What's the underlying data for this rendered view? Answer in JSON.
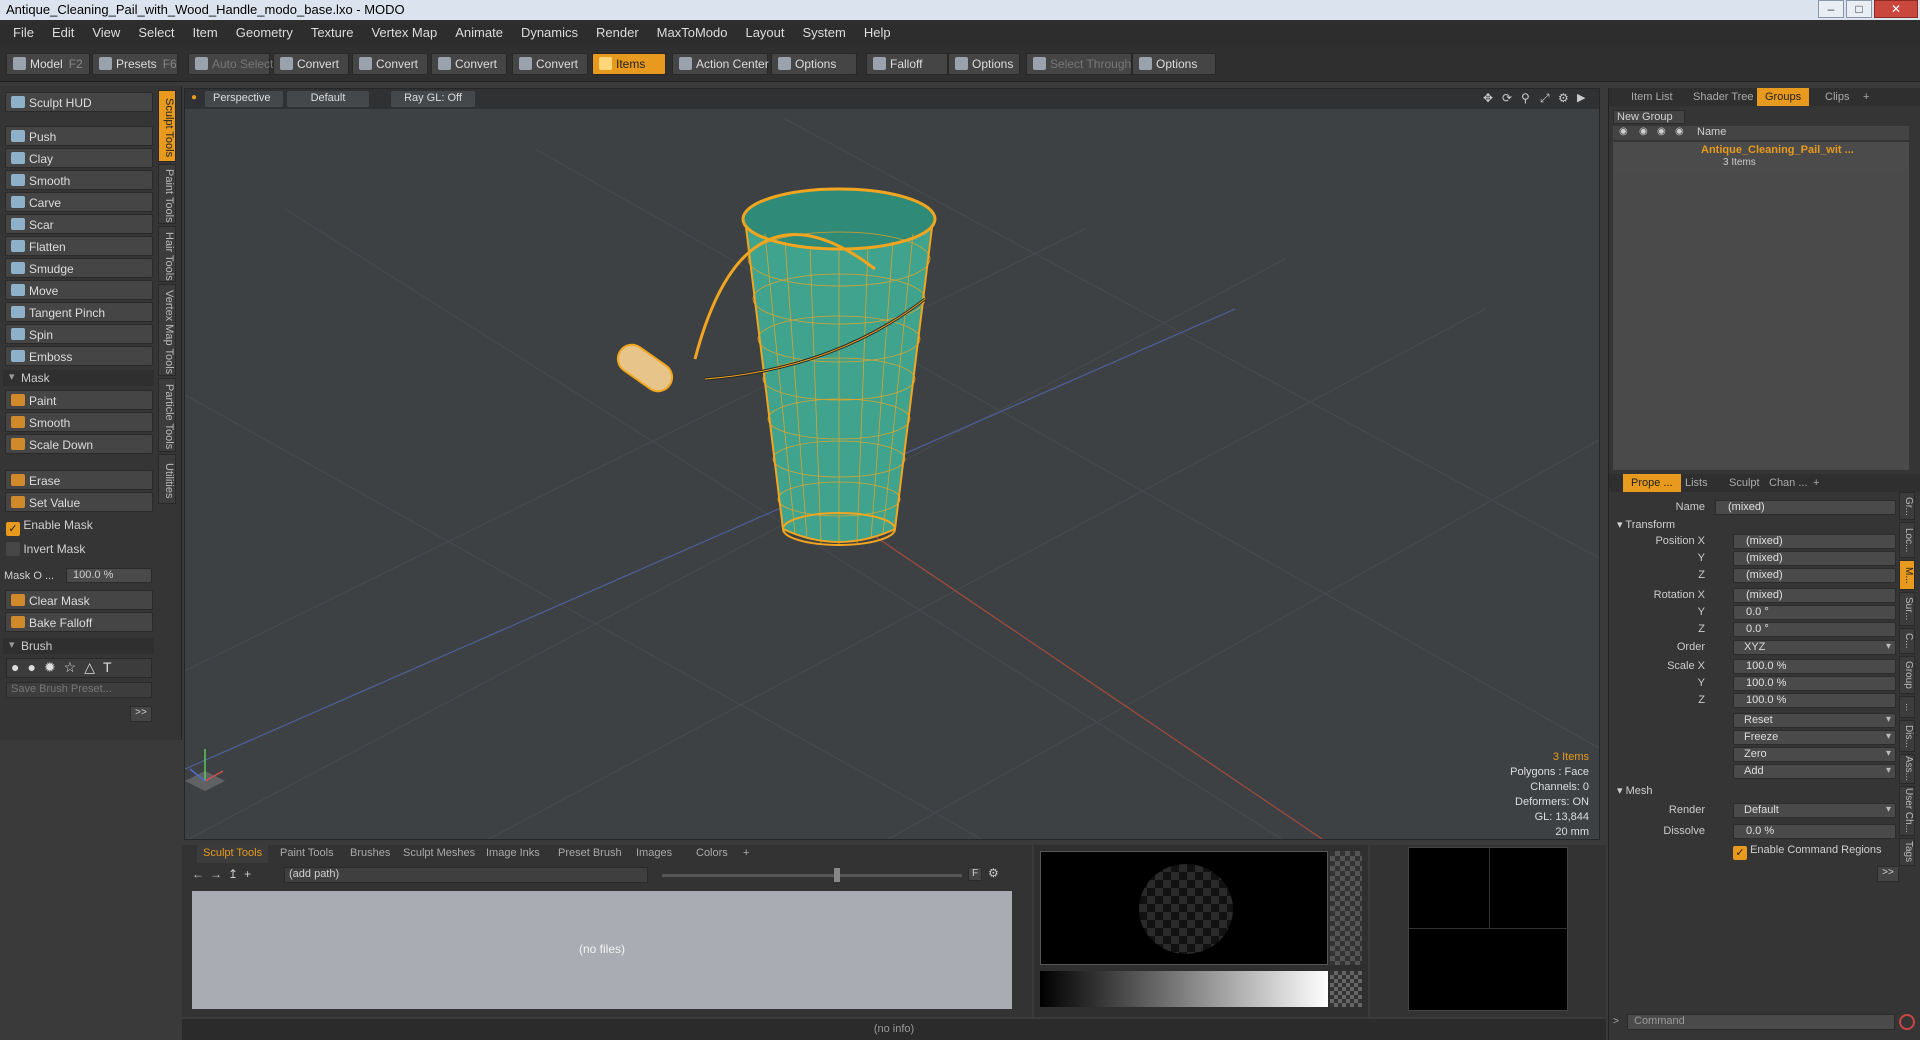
{
  "window": {
    "title": "Antique_Cleaning_Pail_with_Wood_Handle_modo_base.lxo - MODO"
  },
  "menu": [
    "File",
    "Edit",
    "View",
    "Select",
    "Item",
    "Geometry",
    "Texture",
    "Vertex Map",
    "Animate",
    "Dynamics",
    "Render",
    "MaxToModo",
    "Layout",
    "System",
    "Help"
  ],
  "toolbar": {
    "model": "Model",
    "model_key": "F2",
    "presets": "Presets",
    "presets_key": "F6",
    "auto_select": "Auto Select",
    "convert1": "Convert",
    "convert2": "Convert",
    "convert3": "Convert",
    "convert4": "Convert",
    "items": "Items",
    "action_center": "Action Center",
    "options1": "Options",
    "falloff": "Falloff",
    "options2": "Options",
    "select_through": "Select Through",
    "options3": "Options"
  },
  "left": {
    "sculpt_hud": "Sculpt HUD",
    "tools": [
      "Push",
      "Clay",
      "Smooth",
      "Carve",
      "Scar",
      "Flatten",
      "Smudge",
      "Move",
      "Tangent Pinch",
      "Spin",
      "Emboss"
    ],
    "mask_section": "Mask",
    "mask_tools": [
      "Paint",
      "Smooth",
      "Scale Down"
    ],
    "erase": "Erase",
    "set_value": "Set Value",
    "enable_mask": "Enable Mask",
    "invert_mask": "Invert Mask",
    "mask_opacity_label": "Mask O ...",
    "mask_opacity_value": "100.0 %",
    "clear_mask": "Clear Mask",
    "bake_falloff": "Bake Falloff",
    "brush_section": "Brush",
    "save_brush_placeholder": "Save Brush Preset...",
    "more": ">>",
    "vtabs": [
      "Sculpt Tools",
      "Paint Tools",
      "Hair Tools",
      "Vertex Map Tools",
      "Particle Tools",
      "Utilities"
    ]
  },
  "viewport": {
    "perspective": "Perspective",
    "default": "Default",
    "raygl": "Ray GL: Off",
    "info": [
      "3 Items",
      "Polygons : Face",
      "Channels: 0",
      "Deformers: ON",
      "GL: 13,844",
      "20 mm"
    ]
  },
  "bottom": {
    "tabs": [
      "Sculpt Tools",
      "Paint Tools",
      "Brushes",
      "Sculpt Meshes",
      "Image Inks",
      "Preset Brush",
      "Images",
      "Colors",
      "+"
    ],
    "path": "(add path)",
    "no_files": "(no files)",
    "status": "(no info)"
  },
  "right": {
    "tabs_top": [
      "Item List",
      "Shader Tree",
      "Groups",
      "Clips",
      "+"
    ],
    "new_group": "New Group",
    "col_name": "Name",
    "group_name": "Antique_Cleaning_Pail_wit ...",
    "group_count": "3 Items",
    "tabs_props": [
      "Prope ...",
      "Lists",
      "Sculpt",
      "Chan ...",
      "+"
    ],
    "name_label": "Name",
    "name_value": "(mixed)",
    "transform": "Transform",
    "pos_x_label": "Position X",
    "pos_x": "(mixed)",
    "pos_y_label": "Y",
    "pos_y": "(mixed)",
    "pos_z_label": "Z",
    "pos_z": "(mixed)",
    "rot_x_label": "Rotation X",
    "rot_x": "(mixed)",
    "rot_y_label": "Y",
    "rot_y": "0.0 °",
    "rot_z_label": "Z",
    "rot_z": "0.0 °",
    "order_label": "Order",
    "order": "XYZ",
    "scale_x_label": "Scale X",
    "scale_x": "100.0 %",
    "scale_y_label": "Y",
    "scale_y": "100.0 %",
    "scale_z_label": "Z",
    "scale_z": "100.0 %",
    "reset": "Reset",
    "freeze": "Freeze",
    "zero": "Zero",
    "add": "Add",
    "mesh": "Mesh",
    "render_label": "Render",
    "render": "Default",
    "dissolve_label": "Dissolve",
    "dissolve": "0.0 %",
    "enable_cmd_regions": "Enable Command Regions",
    "more": ">>",
    "command_placeholder": "Command",
    "side_tabs": [
      "Gr...",
      "Loc...",
      "M...",
      "Sur...",
      "C...",
      "Group",
      "...",
      "Dis...",
      "Ass...",
      "User Ch...",
      "Tags"
    ]
  },
  "colors": {
    "accent": "#e89a1e",
    "mesh_fill": "#3fa38e",
    "wire": "#f2a51f",
    "handle": "#e7c48a"
  }
}
